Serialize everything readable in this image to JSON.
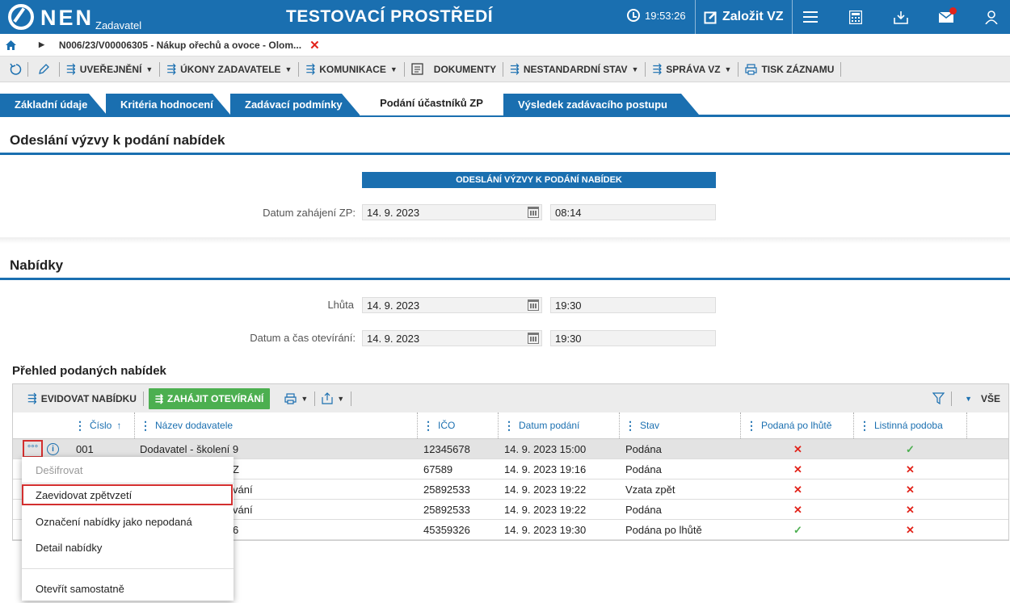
{
  "app": {
    "logo_text": "NEN",
    "logo_sub": "Zadavatel",
    "env_title": "TESTOVACÍ PROSTŘEDÍ",
    "clock": "19:53:26",
    "create_label": "Založit VZ"
  },
  "breadcrumb": {
    "text": "N006/23/V00006305 - Nákup ořechů a ovoce - Olom...",
    "close": "✕"
  },
  "toolbar": {
    "items": [
      {
        "label": "UVEŘEJNĚNÍ"
      },
      {
        "label": "ÚKONY ZADAVATELE"
      },
      {
        "label": "KOMUNIKACE"
      },
      {
        "label": "DOKUMENTY"
      },
      {
        "label": "NESTANDARDNÍ STAV"
      },
      {
        "label": "SPRÁVA VZ"
      },
      {
        "label": "TISK ZÁZNAMU"
      }
    ]
  },
  "tabs": [
    {
      "label": "Základní údaje"
    },
    {
      "label": "Kritéria hodnocení"
    },
    {
      "label": "Zadávací podmínky"
    },
    {
      "label": "Podání účastníků ZP"
    },
    {
      "label": "Výsledek zadávacího postupu"
    }
  ],
  "section1": {
    "title": "Odeslání výzvy k podání nabídek",
    "header": "ODESLÁNÍ VÝZVY K PODÁNÍ NABÍDEK",
    "start_label": "Datum zahájení ZP:",
    "start_date": "14. 9. 2023",
    "start_time": "08:14"
  },
  "section2": {
    "title": "Nabídky",
    "deadline_label": "Lhůta",
    "deadline_date": "14. 9. 2023",
    "deadline_time": "19:30",
    "open_label": "Datum a čas otevírání:",
    "open_date": "14. 9. 2023",
    "open_time": "19:30"
  },
  "grid": {
    "title": "Přehled podaných nabídek",
    "toolbar": {
      "record_label": "EVIDOVAT NABÍDKU",
      "open_label": "ZAHÁJIT OTEVÍRÁNÍ",
      "all_label": "VŠE"
    },
    "columns": {
      "number": "Číslo",
      "supplier": "Název dodavatele",
      "ico": "IČO",
      "date": "Datum podání",
      "status": "Stav",
      "late": "Podaná po lhůtě",
      "paper": "Listinná podoba"
    },
    "rows": [
      {
        "number": "001",
        "supplier": "Dodavatel - školení 9",
        "ico": "12345678",
        "date": "14. 9. 2023 15:00",
        "status": "Podána",
        "late": "✕",
        "paper": "✓"
      },
      {
        "number": "",
        "supplier": "Z",
        "ico": "67589",
        "date": "14. 9. 2023 19:16",
        "status": "Podána",
        "late": "✕",
        "paper": "✕"
      },
      {
        "number": "",
        "supplier": "vání",
        "ico": "25892533",
        "date": "14. 9. 2023 19:22",
        "status": "Vzata zpět",
        "late": "✕",
        "paper": "✕"
      },
      {
        "number": "",
        "supplier": "vání",
        "ico": "25892533",
        "date": "14. 9. 2023 19:22",
        "status": "Podána",
        "late": "✕",
        "paper": "✕"
      },
      {
        "number": "",
        "supplier": "6",
        "ico": "45359326",
        "date": "14. 9. 2023 19:30",
        "status": "Podána po lhůtě",
        "late": "✓",
        "paper": "✕"
      }
    ],
    "row_actions": "°°°",
    "info": "i"
  },
  "context_menu": {
    "decrypt": "Dešifrovat",
    "withdraw": "Zaevidovat zpětvzetí",
    "mark_unsubmitted": "Označení nabídky jako nepodaná",
    "detail": "Detail nabídky",
    "open_separately": "Otevřít samostatně"
  }
}
